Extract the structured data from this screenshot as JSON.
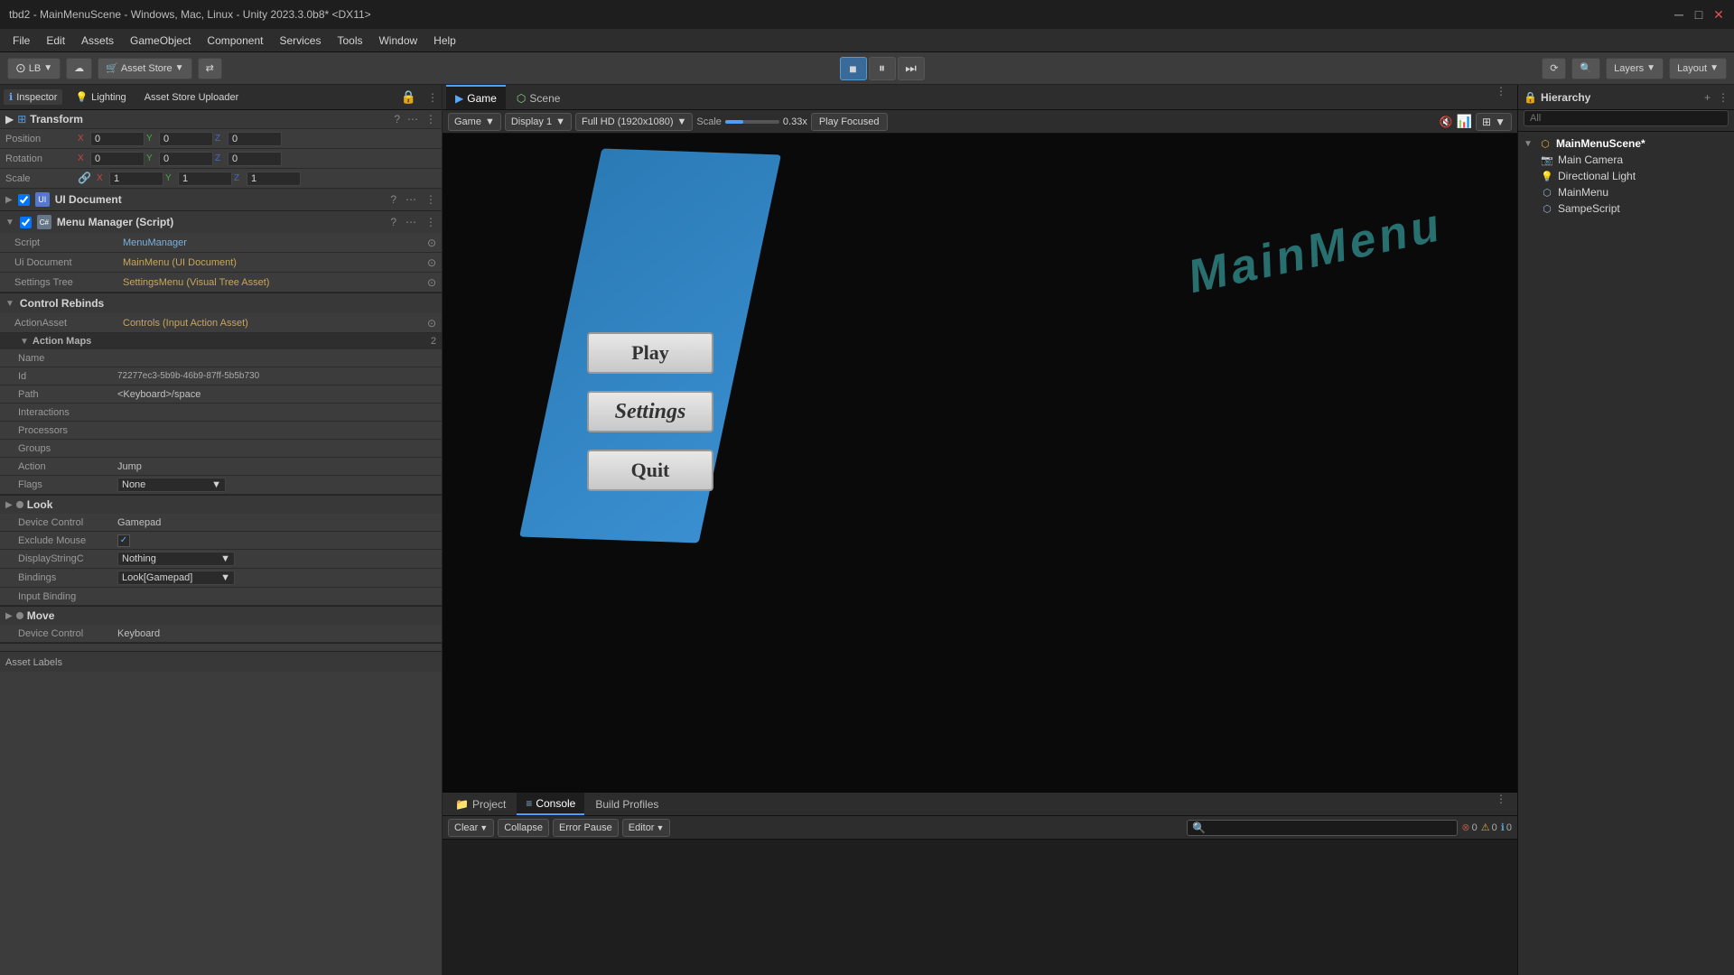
{
  "titleBar": {
    "title": "tbd2 - MainMenuScene - Windows, Mac, Linux - Unity 2023.3.0b8* <DX11>"
  },
  "menuBar": {
    "items": [
      "File",
      "Edit",
      "Assets",
      "GameObject",
      "Component",
      "Services",
      "Tools",
      "Window",
      "Help"
    ]
  },
  "toolbar": {
    "branch": "LB",
    "assetStore": "Asset Store",
    "layers": "Layers",
    "layout": "Layout"
  },
  "playControls": {
    "stop": "■",
    "pause": "⏸",
    "step": "⏭"
  },
  "inspectorTabs": [
    {
      "label": "Inspector",
      "active": true,
      "icon": "inspector"
    },
    {
      "label": "Lighting",
      "active": false,
      "icon": "lighting"
    },
    {
      "label": "Asset Store Uploader",
      "active": false,
      "icon": "uploader"
    }
  ],
  "transform": {
    "title": "Transform",
    "position": {
      "label": "Position",
      "x": "0",
      "y": "0",
      "z": "0"
    },
    "rotation": {
      "label": "Rotation",
      "x": "0",
      "y": "0",
      "z": "0"
    },
    "scale": {
      "label": "Scale",
      "x": "1",
      "y": "1",
      "z": "1"
    }
  },
  "uiDocument": {
    "title": "UI Document",
    "enabled": true
  },
  "menuManager": {
    "title": "Menu Manager (Script)",
    "enabled": true,
    "script": {
      "label": "Script",
      "value": "MenuManager"
    },
    "uiDocument": {
      "label": "Ui Document",
      "value": "MainMenu (UI Document)"
    },
    "settingsTree": {
      "label": "Settings Tree",
      "value": "SettingsMenu (Visual Tree Asset)"
    }
  },
  "controlRebinds": {
    "title": "Control Rebinds",
    "actionAsset": {
      "label": "ActionAsset",
      "value": "Controls (Input Action Asset)"
    },
    "actionMaps": {
      "label": "Action Maps",
      "count": "2",
      "fields": [
        {
          "label": "Name",
          "value": ""
        },
        {
          "label": "Id",
          "value": "72277ec3-5b9b-46b9-87ff-5b5b730"
        },
        {
          "label": "Path",
          "value": "<Keyboard>/space"
        },
        {
          "label": "Interactions",
          "value": ""
        },
        {
          "label": "Processors",
          "value": ""
        },
        {
          "label": "Groups",
          "value": ""
        },
        {
          "label": "Action",
          "value": "Jump"
        },
        {
          "label": "Flags",
          "value": "None"
        }
      ]
    }
  },
  "lookSection": {
    "title": "Look",
    "deviceControl": {
      "label": "Device Control",
      "value": "Gamepad"
    },
    "excludeMouse": {
      "label": "Exclude Mouse",
      "checked": true
    },
    "displayStringC": {
      "label": "DisplayStringC",
      "value": "Nothing"
    },
    "bindings": {
      "label": "Bindings",
      "value": "Look[Gamepad]"
    },
    "inputBinding": {
      "label": "Input Binding"
    }
  },
  "moveSection": {
    "title": "Move",
    "deviceControl": {
      "label": "Device Control",
      "value": "Keyboard"
    }
  },
  "assetLabels": "Asset Labels",
  "gameTabs": [
    {
      "label": "Game",
      "active": true,
      "icon": "game"
    },
    {
      "label": "Scene",
      "active": false,
      "icon": "scene"
    }
  ],
  "gameToolbar": {
    "gameMode": "Game",
    "display": "Display 1",
    "resolution": "Full HD (1920x1080)",
    "scaleLabel": "Scale",
    "scaleValue": "0.33x",
    "playFocused": "Play Focused"
  },
  "gameScene": {
    "menuTitle": "MainMenu",
    "buttons": [
      {
        "label": "Play"
      },
      {
        "label": "Settings"
      },
      {
        "label": "Quit"
      }
    ]
  },
  "bottomTabs": [
    {
      "label": "Project",
      "active": false,
      "icon": "folder"
    },
    {
      "label": "Console",
      "active": true,
      "icon": "console"
    },
    {
      "label": "Build Profiles",
      "active": false,
      "icon": "build"
    }
  ],
  "consoleToolbar": {
    "clear": "Clear",
    "collapse": "Collapse",
    "errorPause": "Error Pause",
    "editor": "Editor",
    "searchPlaceholder": "",
    "errorCount": "0",
    "warningCount": "0",
    "infoCount": "0"
  },
  "hierarchy": {
    "title": "Hierarchy",
    "searchPlaceholder": "All",
    "items": [
      {
        "label": "MainMenuScene*",
        "type": "scene",
        "level": 0,
        "hasArrow": true,
        "expanded": true
      },
      {
        "label": "Main Camera",
        "type": "object",
        "level": 1,
        "hasArrow": false
      },
      {
        "label": "Directional Light",
        "type": "object",
        "level": 1,
        "hasArrow": false
      },
      {
        "label": "MainMenu",
        "type": "object",
        "level": 1,
        "hasArrow": false
      },
      {
        "label": "SampeScript",
        "type": "object",
        "level": 1,
        "hasArrow": false
      }
    ]
  }
}
